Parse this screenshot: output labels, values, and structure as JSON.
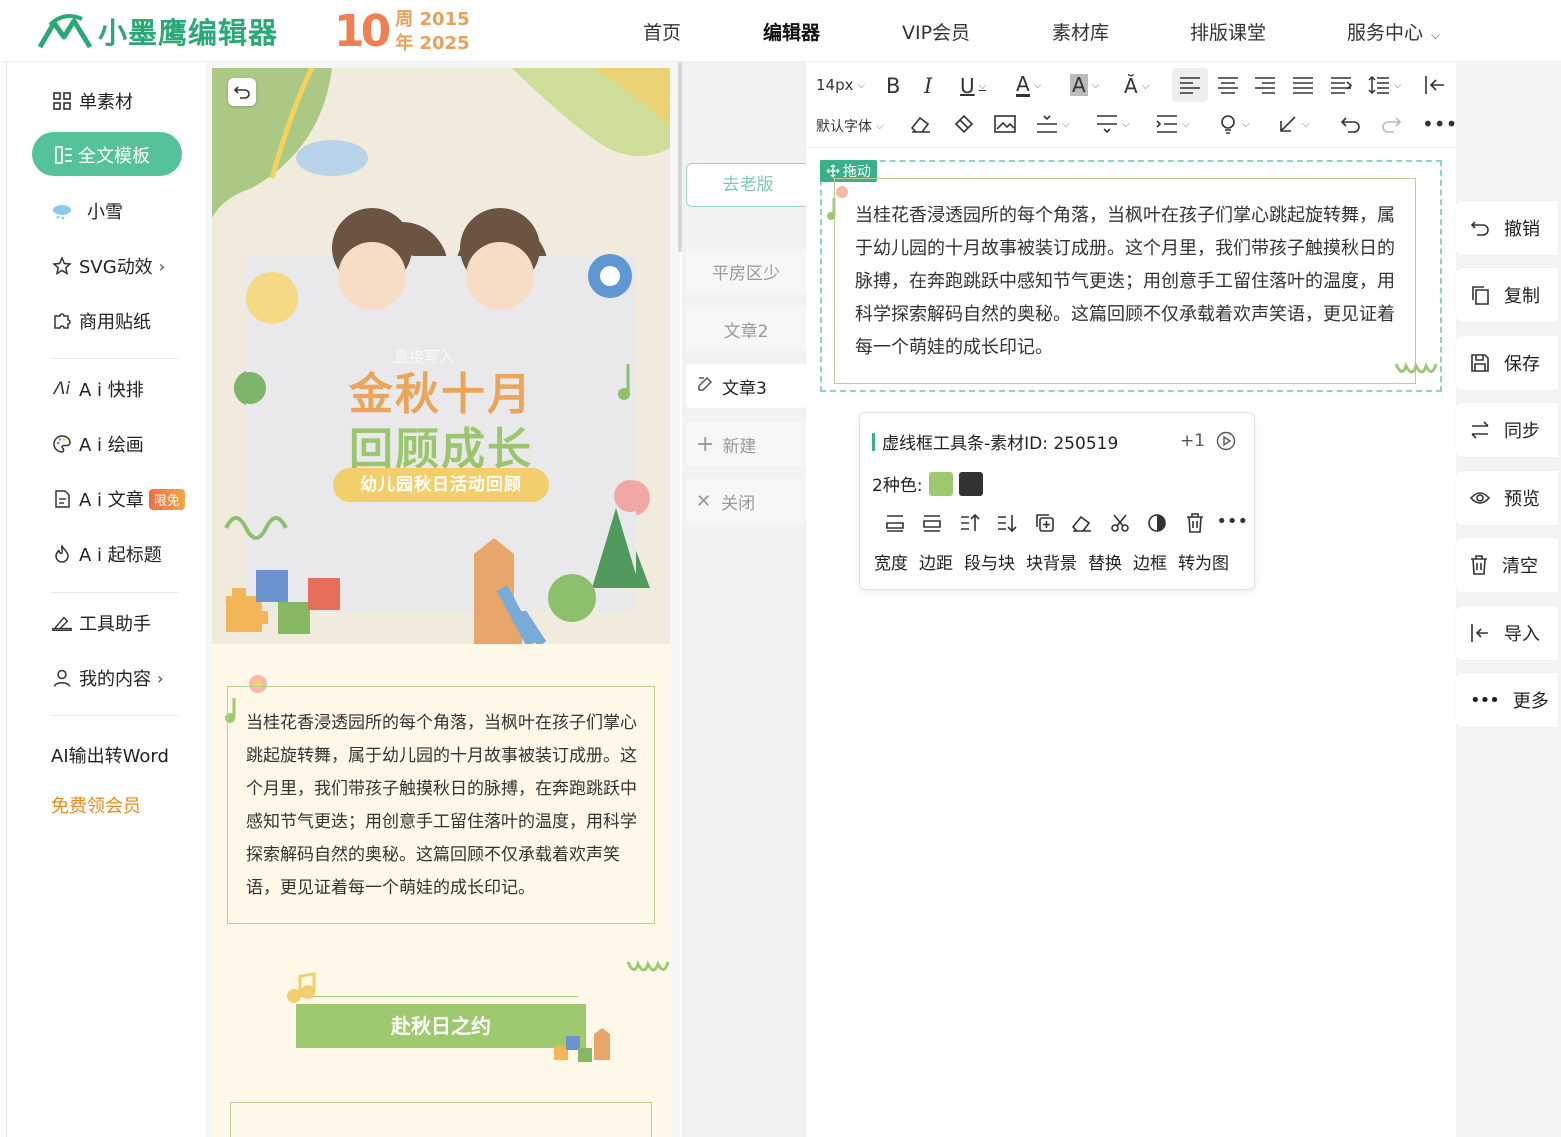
{
  "header": {
    "logo_text": "小墨鹰编辑器",
    "anniversary_number": "10",
    "anniversary_line1": "周 2015",
    "anniversary_line2": "年 2025",
    "nav": [
      {
        "label": "首页",
        "active": false
      },
      {
        "label": "编辑器",
        "active": true
      },
      {
        "label": "VIP会员",
        "active": false
      },
      {
        "label": "素材库",
        "active": false
      },
      {
        "label": "排版课堂",
        "active": false
      },
      {
        "label": "服务中心",
        "active": false,
        "dropdown": true
      }
    ]
  },
  "sidebar": {
    "items": [
      {
        "label": "单素材",
        "icon": "grid-icon"
      },
      {
        "label": "全文模板",
        "icon": "template-icon",
        "active": true
      },
      {
        "label": "小雪",
        "icon": "snow-cloud-icon"
      },
      {
        "label": "SVG动效",
        "icon": "star-icon",
        "chevron": "›"
      },
      {
        "label": "商用贴纸",
        "icon": "puzzle-icon"
      },
      {
        "label": "A i 快排",
        "icon": "ai-layout-icon"
      },
      {
        "label": "A i 绘画",
        "icon": "palette-icon"
      },
      {
        "label": "A i 文章",
        "icon": "document-icon",
        "badge": "限免"
      },
      {
        "label": "A i 起标题",
        "icon": "flame-icon"
      },
      {
        "label": "工具助手",
        "icon": "tool-icon"
      },
      {
        "label": "我的内容",
        "icon": "user-icon",
        "chevron": "›"
      },
      {
        "label": "AI输出转Word",
        "icon": ""
      },
      {
        "label": "免费领会员",
        "icon": ""
      }
    ],
    "accent_color": "#56c29a",
    "promo_color": "#e8891e"
  },
  "preview": {
    "overlay_hint": "直接写入",
    "poster_title1": "金秋十月",
    "poster_title2": "回顾成长",
    "poster_subtitle": "幼儿园秋日活动回顾",
    "body_text": "当桂花香浸透园所的每个角落，当枫叶在孩子们掌心跳起旋转舞，属于幼儿园的十月故事被装订成册。这个月里，我们带孩子触摸秋日的脉搏，在奔跑跳跃中感知节气更迭；用创意手工留住落叶的温度，用科学探索解码自然的奥秘。这篇回顾不仅承载着欢声笑语，更见证着每一个萌娃的成长印记。",
    "section_title": "赴秋日之约"
  },
  "tabs": {
    "old_version": "去老版",
    "items": [
      {
        "label": "平房区少",
        "active": false
      },
      {
        "label": "文章2",
        "active": false
      },
      {
        "label": "文章3",
        "active": true,
        "icon": "edit-icon"
      },
      {
        "label": "新建",
        "icon": "plus-icon"
      },
      {
        "label": "关闭",
        "icon": "close-icon"
      }
    ]
  },
  "toolbar": {
    "font_size": "14px",
    "font_family": "默认字体"
  },
  "editor": {
    "drag_label": "拖动",
    "text": "当桂花香浸透园所的每个角落，当枫叶在孩子们掌心跳起旋转舞，属于幼儿园的十月故事被装订成册。这个月里，我们带孩子触摸秋日的脉搏，在奔跑跳跃中感知节气更迭；用创意手工留住落叶的温度，用科学探索解码自然的奥秘。这篇回顾不仅承载着欢声笑语，更见证着每一个萌娃的成长印记。",
    "popup": {
      "title": "虚线框工具条-素材ID: 250519",
      "plus": "+1",
      "colors_label": "2种色:",
      "colors": [
        "#9cc96f",
        "#333333"
      ],
      "labels": [
        "宽度",
        "边距",
        "段与块",
        "块背景",
        "替换",
        "边框",
        "转为图"
      ]
    }
  },
  "actions": [
    {
      "label": "撤销",
      "icon": "undo-icon"
    },
    {
      "label": "复制",
      "icon": "copy-icon"
    },
    {
      "label": "保存",
      "icon": "save-icon"
    },
    {
      "label": "同步",
      "icon": "sync-icon"
    },
    {
      "label": "预览",
      "icon": "eye-icon"
    },
    {
      "label": "清空",
      "icon": "trash-icon"
    },
    {
      "label": "导入",
      "icon": "import-icon"
    },
    {
      "label": "更多",
      "icon": "more-icon"
    }
  ]
}
